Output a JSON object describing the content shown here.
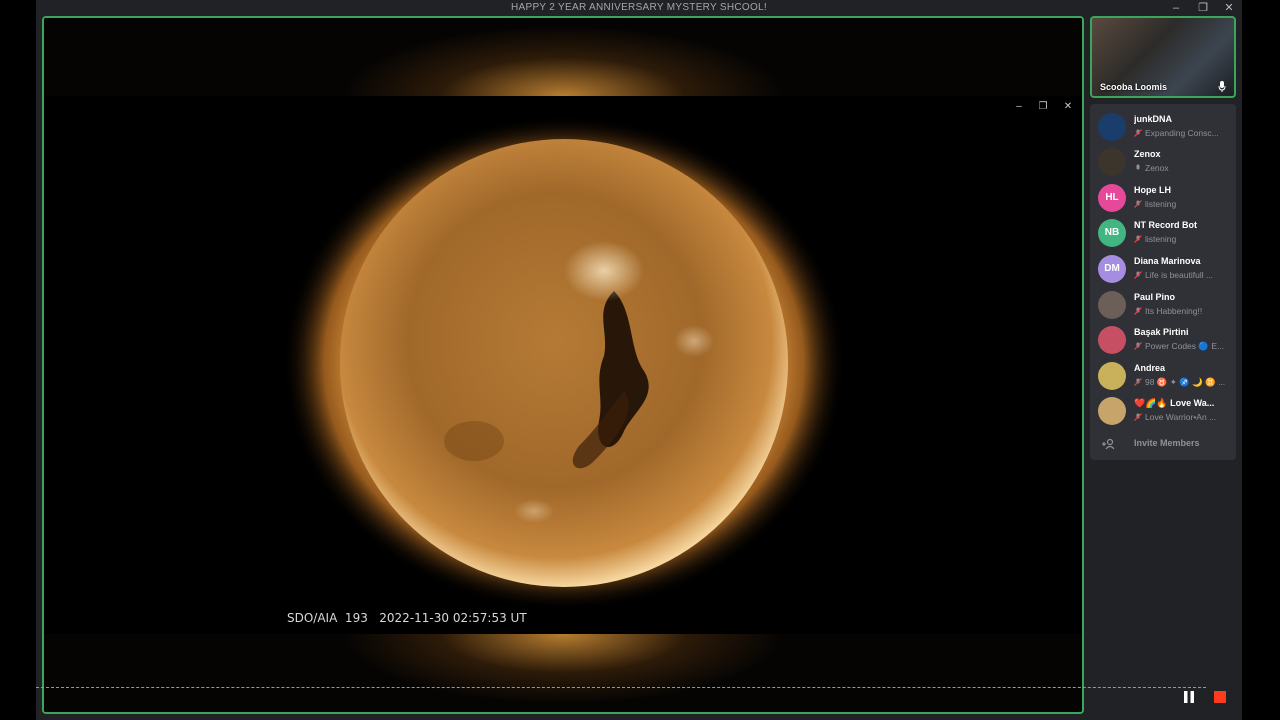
{
  "window": {
    "title": "HAPPY 2 YEAR ANNIVERSARY MYSTERY SHCOOL!",
    "minimize": "–",
    "restore": "❐",
    "close": "✕"
  },
  "stream": {
    "minimize": "–",
    "restore": "❐",
    "close": "✕",
    "caption": "SDO/AIA  193   2022-11-30 02:57:53 UT",
    "sun_color": "#c98a3e"
  },
  "self": {
    "name": "Scooba Loomis"
  },
  "members": [
    {
      "name": "junkDNA",
      "status": "Expanding Consc...",
      "initials": "",
      "avatar_color": "#1a3d6b",
      "icon": "muted-icon"
    },
    {
      "name": "Zenox",
      "status": "Zenox",
      "initials": "",
      "avatar_color": "#3b352c",
      "icon": "mic-icon"
    },
    {
      "name": "Hope LH",
      "status": "listening",
      "initials": "HL",
      "avatar_color": "#e7499a",
      "icon": "muted-icon"
    },
    {
      "name": "NT Record Bot",
      "status": "listening",
      "initials": "NB",
      "avatar_color": "#43b581",
      "icon": "muted-icon"
    },
    {
      "name": "Diana Marinova",
      "status": "Life is beautifull ...",
      "initials": "DM",
      "avatar_color": "#a58ee2",
      "icon": "muted-icon"
    },
    {
      "name": "Paul Pino",
      "status": "Its Habbening!!",
      "initials": "",
      "avatar_color": "#6b5f57",
      "icon": "muted-icon"
    },
    {
      "name": "Başak Pirtini",
      "status": "Power Codes 🔵 E...",
      "initials": "",
      "avatar_color": "#c74f63",
      "icon": "muted-icon"
    },
    {
      "name": "Andrea",
      "status": "98 ♉ ✦ ♐ 🌙 ♊ ...",
      "initials": "",
      "avatar_color": "#c9b05a",
      "icon": "muted-icon"
    },
    {
      "name": "❤️🌈🔥 Love Wa...",
      "status": "Love Warrior•An ...",
      "initials": "",
      "avatar_color": "#c7a46a",
      "icon": "muted-icon"
    }
  ],
  "invite": {
    "label": "Invite Members"
  },
  "recording": {
    "pause_icon": "pause-icon",
    "stop_icon": "stop-icon"
  }
}
